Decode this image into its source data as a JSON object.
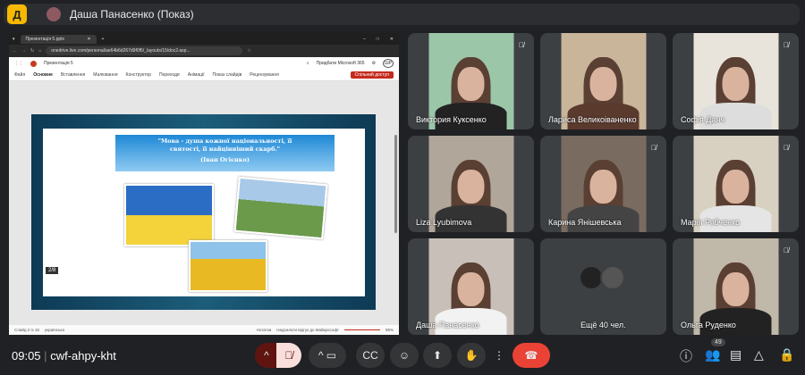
{
  "presenter": {
    "logo": "Д",
    "name": "Даша Панасенко (Показ)"
  },
  "browser": {
    "tab_title": "Презентація 5.pptx",
    "url": "onedrive.live.com/personal/ae64b6d267d9f0f5/_layouts/15/doc2.asp..."
  },
  "ppt": {
    "file": "Презентація 5",
    "buy": "Придбати Microsoft 365",
    "avatar": "ШР",
    "ribbon": [
      "Файл",
      "Основне",
      "Вставлення",
      "Малювання",
      "Конструктор",
      "Переходи",
      "Анімації",
      "Показ слайдів",
      "Рецензування"
    ],
    "share": "Спільний доступ",
    "slide_counter": "2/8",
    "quote_line1": "\"Мова - душа кожної національності, її",
    "quote_line2": "святості, її найцінніший скарб.\"",
    "quote_author": "(Іван Огієнко)",
    "status_slide": "Слайд 2 із 18",
    "status_lang": "українська",
    "status_notes": "Нотатки",
    "status_feedback": "Надсилати відгук до Майкрософт",
    "zoom": "85%"
  },
  "participants": [
    {
      "name": "Виктория Куксенко",
      "muted": true
    },
    {
      "name": "Лариса Великоіваненко",
      "muted": false
    },
    {
      "name": "Софія Данч",
      "muted": true
    },
    {
      "name": "Liza Lyubimova",
      "muted": false
    },
    {
      "name": "Карина Янішевська",
      "muted": true
    },
    {
      "name": "Марія Рябченко",
      "muted": true
    },
    {
      "name": "Даша Панасенко",
      "muted": false
    },
    {
      "name": "Ещё 40 чел.",
      "muted": false
    },
    {
      "name": "Ольга Руденко",
      "muted": true
    }
  ],
  "meeting": {
    "time": "09:05",
    "code": "cwf-ahpy-kht",
    "people_count": "49"
  },
  "colors": {
    "end_call": "#ea4335",
    "mic_off": "#f9dedc",
    "bg": "#202124"
  }
}
